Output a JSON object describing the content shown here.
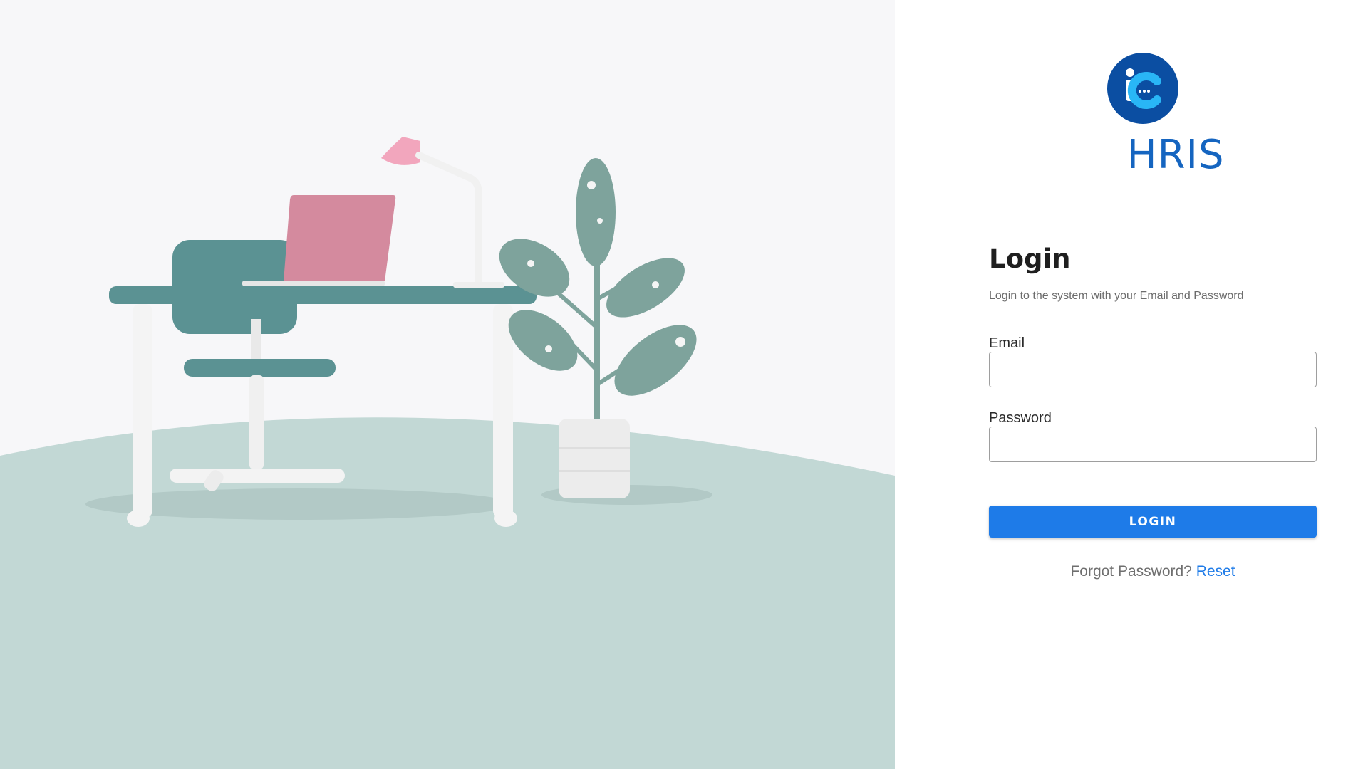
{
  "brand": {
    "name": "HRIS",
    "logo_icon": "hris-logo-icon",
    "logo_color": "#0b4ea2",
    "logo_accent": "#29b6f6"
  },
  "login": {
    "title": "Login",
    "subtitle": "Login to the system with your Email and Password",
    "email_label": "Email",
    "email_value": "",
    "password_label": "Password",
    "password_value": "",
    "button_label": "LOGIN",
    "forgot_text": "Forgot Password?",
    "reset_link": "Reset"
  },
  "colors": {
    "accent": "#1e7be8",
    "brand_text": "#1565c0",
    "hero_floor": "#c2d8d5",
    "hero_background": "#f7f7f9"
  },
  "hero": {
    "illustration": "office-desk-illustration"
  }
}
